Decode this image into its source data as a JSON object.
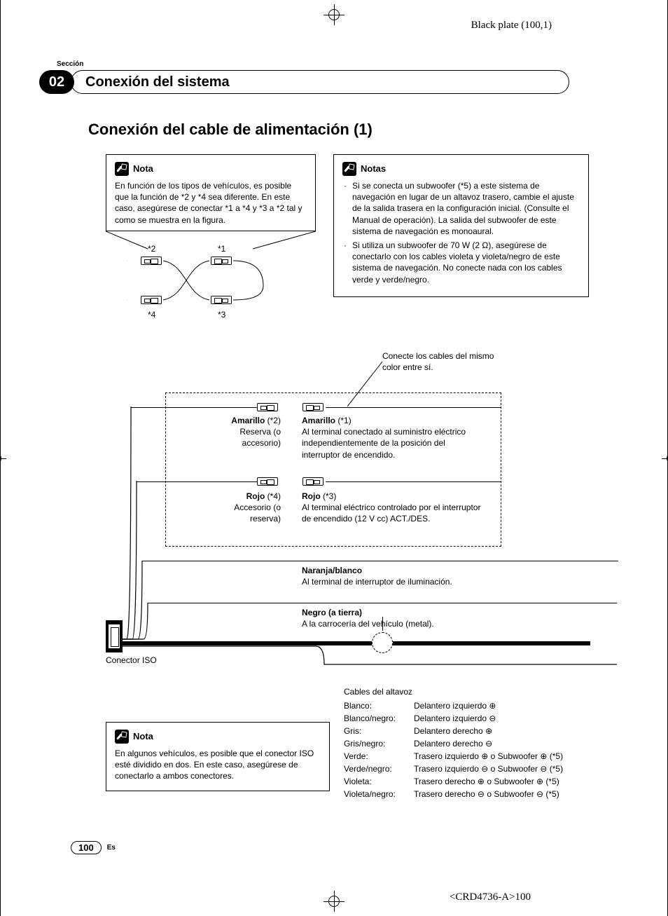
{
  "plate": "Black plate (100,1)",
  "section_label": "Sección",
  "section_number": "02",
  "section_title": "Conexión del sistema",
  "h1": "Conexión del cable de alimentación (1)",
  "note1": {
    "title": "Nota",
    "body": "En función de los tipos de vehículos, es posible que la función de *2 y *4 sea diferente. En este caso, asegúrese de conectar *1 a *4 y *3 a *2 tal y como se muestra en la figura."
  },
  "note2": {
    "title": "Notas",
    "items": [
      "Si se conecta un subwoofer (*5) a este sistema de navegación en lugar de un altavoz trasero, cambie el ajuste de la salida trasera en la configuración inicial. (Consulte el Manual de operación). La salida del subwoofer de este sistema de navegación es monoaural.",
      "Si utiliza un subwoofer de 70 W (2 Ω), asegúrese de conectarlo con los cables violeta y violeta/negro de este sistema de navegación. No conecte nada con los cables verde y verde/negro."
    ]
  },
  "cross": {
    "t1": "*1",
    "t2": "*2",
    "t3": "*3",
    "t4": "*4"
  },
  "same_color_note": "Conecte los cables del mismo color entre sí.",
  "wires": {
    "amarillo2": {
      "name": "Amarillo",
      "ref": "(*2)",
      "desc": "Reserva (o accesorio)"
    },
    "amarillo1": {
      "name": "Amarillo",
      "ref": "(*1)",
      "desc": "Al terminal conectado al suministro eléctrico independientemente de la posición del interruptor de encendido."
    },
    "rojo4": {
      "name": "Rojo",
      "ref": "(*4)",
      "desc": "Accesorio (o reserva)"
    },
    "rojo3": {
      "name": "Rojo",
      "ref": "(*3)",
      "desc": "Al terminal eléctrico controlado por el interruptor de encendido (12 V cc) ACT./DES."
    },
    "naranja": {
      "name": "Naranja/blanco",
      "desc": "Al terminal de interruptor de iluminación."
    },
    "negro": {
      "name": "Negro (a tierra)",
      "desc": "A la carrocería del vehículo (metal)."
    }
  },
  "iso_connector": "Conector ISO",
  "note3": {
    "title": "Nota",
    "body": "En algunos vehículos, es posible que el conector ISO esté dividido en dos. En este caso, asegúrese de conectarlo a ambos conectores."
  },
  "speaker": {
    "head": "Cables del altavoz",
    "rows": [
      {
        "c": "Blanco:",
        "v": "Delantero izquierdo ⊕"
      },
      {
        "c": "Blanco/negro:",
        "v": "Delantero izquierdo ⊖"
      },
      {
        "c": "Gris:",
        "v": "Delantero derecho ⊕"
      },
      {
        "c": "Gris/negro:",
        "v": "Delantero derecho ⊖"
      },
      {
        "c": "Verde:",
        "v": "Trasero izquierdo ⊕ o Subwoofer ⊕ (*5)"
      },
      {
        "c": "Verde/negro:",
        "v": "Trasero izquierdo ⊖ o Subwoofer ⊖ (*5)"
      },
      {
        "c": "Violeta:",
        "v": "Trasero derecho ⊕ o Subwoofer ⊕ (*5)"
      },
      {
        "c": "Violeta/negro:",
        "v": "Trasero derecho ⊖ o Subwoofer ⊖ (*5)"
      }
    ]
  },
  "page_number": "100",
  "lang": "Es",
  "footer_code": "<CRD4736-A>100"
}
